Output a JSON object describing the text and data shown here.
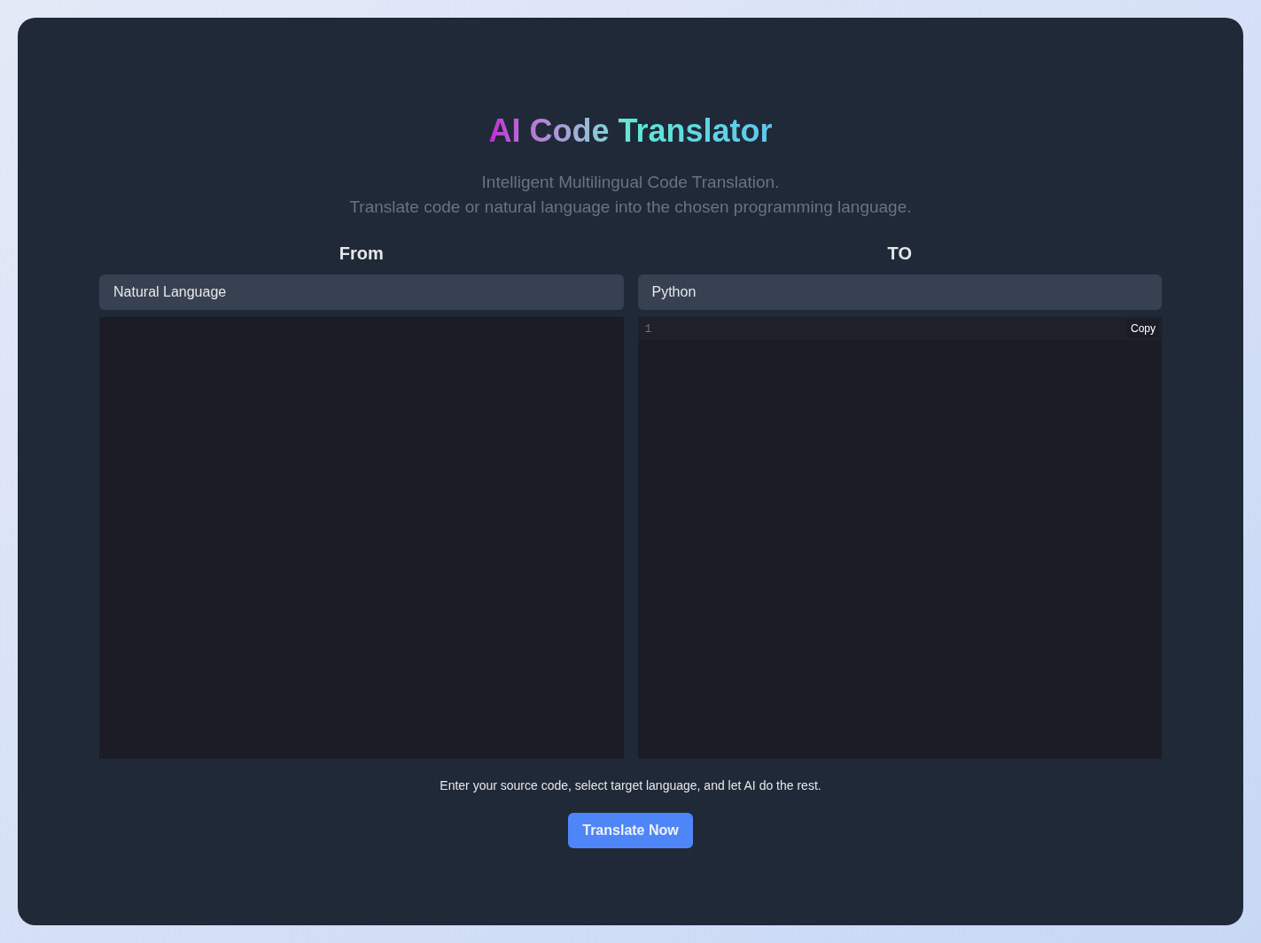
{
  "title": "AI Code Translator",
  "subtitle": [
    "Intelligent Multilingual Code Translation.",
    "Translate code or natural language into the chosen programming language."
  ],
  "source": {
    "heading": "From",
    "language": "Natural Language"
  },
  "target": {
    "heading": "TO",
    "language": "Python",
    "line_numbers": [
      "1"
    ],
    "copy_button": "Copy"
  },
  "hint": "Enter your source code, select target language, and let AI do the rest.",
  "translate_button": "Translate Now"
}
